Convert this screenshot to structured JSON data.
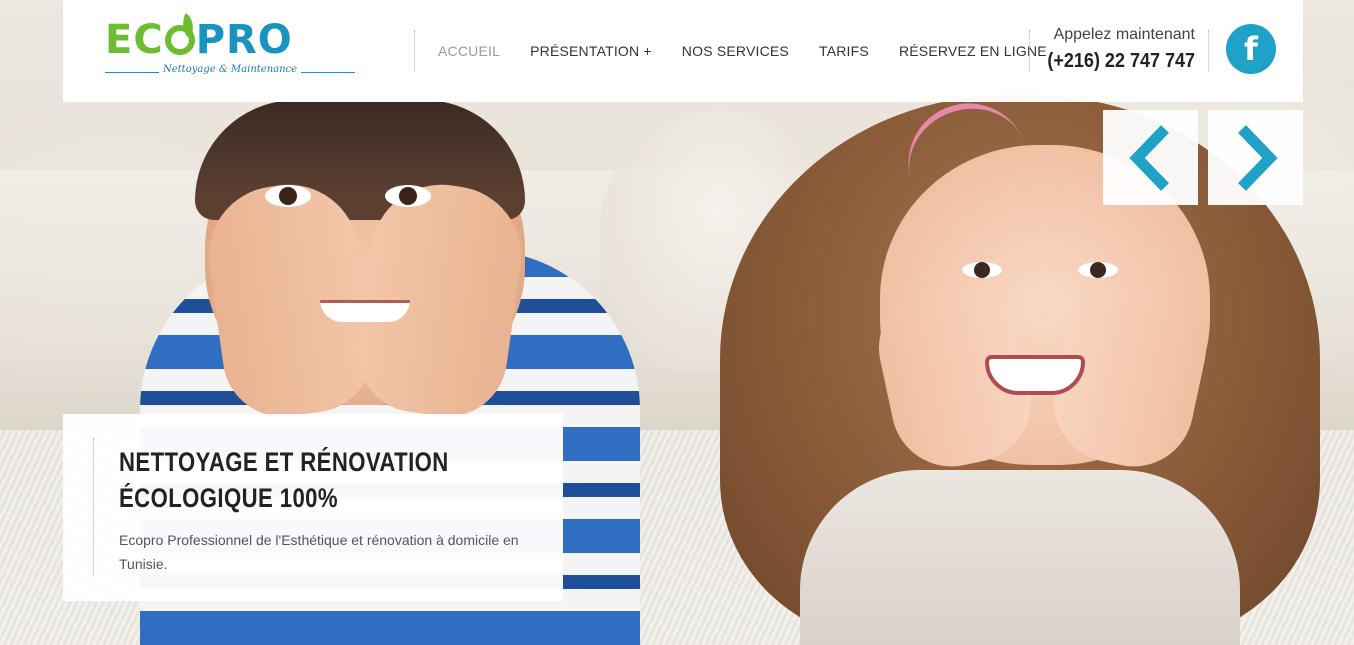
{
  "logo": {
    "eco": "EC",
    "pro": "PRO",
    "tagline": "Nettoyage & Maintenance"
  },
  "nav": {
    "items": [
      {
        "label": "ACCUEIL",
        "active": true
      },
      {
        "label": "PRÉSENTATION +",
        "active": false
      },
      {
        "label": "NOS SERVICES",
        "active": false
      },
      {
        "label": "TARIFS",
        "active": false
      },
      {
        "label": "RÉSERVEZ EN LIGNE",
        "active": false
      }
    ]
  },
  "contact": {
    "label": "Appelez maintenant",
    "phone": "(+216) 22 747 747"
  },
  "social": {
    "facebook_glyph": "f",
    "facebook_icon": "facebook-icon"
  },
  "slider": {
    "prev_icon": "chevron-left-icon",
    "next_icon": "chevron-right-icon"
  },
  "caption": {
    "title": "NETTOYAGE ET RÉNOVATION ÉCOLOGIQUE 100%",
    "text": "Ecopro Professionnel de l'Esthétique et rénovation à domicile en Tunisie."
  },
  "colors": {
    "brand_green": "#6cbd2f",
    "brand_blue": "#1a93c0",
    "accent": "#1ea2c7"
  }
}
